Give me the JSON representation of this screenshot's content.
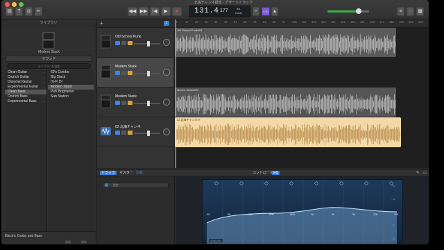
{
  "window": {
    "title": "北海チャンネ録音 - デザートトラック",
    "colors": {
      "accent": "#3d7fd6",
      "record": "#e24a3b",
      "audio_region": "#f0c890",
      "selected_region": "#f3d9a7"
    }
  },
  "toolbar": {
    "library_icon": "library-icon",
    "help_icon": "help-icon",
    "smart_controls_icon": "smart-controls-icon",
    "editors_icon": "scissors-icon",
    "rewind_icon": "rewind-icon",
    "forward_icon": "fast-forward-icon",
    "goto_start_icon": "go-to-beginning-icon",
    "play_icon": "play-icon",
    "record_icon": "record-icon",
    "cycle_icon": "cycle-icon",
    "time": "131.4",
    "tempo": "177",
    "time_signature": "4/4",
    "key": "Cmaj",
    "tuner_icon": "tuning-fork-icon",
    "count_in": "1234",
    "metronome_icon": "metronome-icon",
    "notepad_icon": "notepad-icon",
    "loops_icon": "loop-icon",
    "media_icon": "media-browser-icon",
    "master_volume_fraction": 0.75
  },
  "library": {
    "header": "ライブラリ",
    "patch_name": "Modern Stack",
    "sound_header": "サウンド",
    "search_placeholder": "ライブラリを検索",
    "categories": [
      {
        "label": "Clean Guitar"
      },
      {
        "label": "Crunch Guitar"
      },
      {
        "label": "Distorted Guitar"
      },
      {
        "label": "Experimental Guitar"
      },
      {
        "label": "Clean Bass"
      },
      {
        "label": "Crunch Bass"
      },
      {
        "label": "Experimental Bass"
      }
    ],
    "selected_category_index": 4,
    "presets": [
      {
        "label": "60's Combo"
      },
      {
        "label": "Big Stack"
      },
      {
        "label": "Hi-Fi DI"
      },
      {
        "label": "Modern Stack"
      },
      {
        "label": "Pick Brightener"
      },
      {
        "label": "Sub Station"
      }
    ],
    "selected_preset_index": 3,
    "footer_instrument": "Electric Guitar and Bass",
    "footer_revert": "復帰",
    "footer_delete": "削除"
  },
  "tracks": [
    {
      "name": "Old School Punk",
      "region_label": "Old School Punk#04"
    },
    {
      "name": "Modern Stack",
      "region_label": ""
    },
    {
      "name": "Modern Stack",
      "region_label": "Modern Stack#02"
    },
    {
      "name": "02 北海チャンネ",
      "region_label": "02 北海チャンネ ®"
    }
  ],
  "ruler": {
    "marks": [
      "9",
      "17",
      "25",
      "33",
      "41",
      "49",
      "57",
      "65",
      "73",
      "81",
      "89",
      "97",
      "105",
      "113",
      "121",
      "129",
      "137",
      "145",
      "153",
      "161",
      "169",
      "177",
      "185",
      "193",
      "201",
      "209"
    ]
  },
  "editor": {
    "tab_track": "トラック",
    "tab_master": "マスター",
    "tab_compare": "比較",
    "tab_controls": "コントロール",
    "tab_eq": "EQ",
    "preset_label": "設定",
    "analyzer_label": "Analyzer",
    "eq_freqs": [
      "20",
      "50",
      "100",
      "200",
      "500",
      "1k",
      "2k",
      "5k",
      "10k",
      "20k"
    ],
    "eq_db": [
      "+24",
      "+12",
      "0",
      "-12",
      "-24"
    ]
  }
}
